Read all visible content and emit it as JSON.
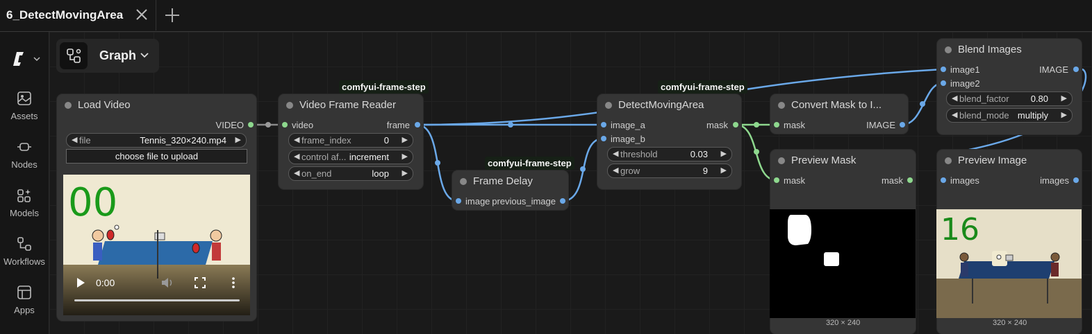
{
  "tab": {
    "title": "6_DetectMovingArea"
  },
  "sidebar": {
    "items": [
      {
        "label": "Assets",
        "icon": "image-icon"
      },
      {
        "label": "Nodes",
        "icon": "node-icon"
      },
      {
        "label": "Models",
        "icon": "models-icon"
      },
      {
        "label": "Workflows",
        "icon": "workflow-icon"
      },
      {
        "label": "Apps",
        "icon": "apps-icon"
      }
    ]
  },
  "graph_button": {
    "label": "Graph"
  },
  "groups": [
    "comfyui-frame-step",
    "comfyui-frame-step",
    "comfyui-frame-step"
  ],
  "nodes": {
    "load_video": {
      "title": "Load Video",
      "output": "VIDEO",
      "file_name": "file",
      "file_value": "Tennis_320×240.mp4",
      "upload_label": "choose file to upload",
      "preview_number": "00",
      "time": "0:00"
    },
    "frame_reader": {
      "title": "Video Frame Reader",
      "input": "video",
      "output": "frame",
      "w1_name": "frame_index",
      "w1_value": "0",
      "w2_name": "control af...",
      "w2_value": "increment",
      "w3_name": "on_end",
      "w3_value": "loop"
    },
    "frame_delay": {
      "title": "Frame Delay",
      "input": "image",
      "output": "previous_image"
    },
    "detect": {
      "title": "DetectMovingArea",
      "input1": "image_a",
      "input2": "image_b",
      "output": "mask",
      "w1_name": "threshold",
      "w1_value": "0.03",
      "w2_name": "grow",
      "w2_value": "9"
    },
    "convert": {
      "title": "Convert Mask to I...",
      "input": "mask",
      "output": "IMAGE"
    },
    "preview_mask": {
      "title": "Preview Mask",
      "input": "mask",
      "output": "mask",
      "dims": "320 × 240"
    },
    "blend": {
      "title": "Blend Images",
      "input1": "image1",
      "input2": "image2",
      "output": "IMAGE",
      "w1_name": "blend_factor",
      "w1_value": "0.80",
      "w2_name": "blend_mode",
      "w2_value": "multiply"
    },
    "preview_image": {
      "title": "Preview Image",
      "input": "images",
      "output": "images",
      "preview_number": "16",
      "dims": "320 × 240"
    }
  },
  "colors": {
    "image_wire": "#6aa8e8",
    "mask_wire": "#8ed88e",
    "node_bg": "#353535",
    "canvas_bg": "#1a1a1a"
  }
}
